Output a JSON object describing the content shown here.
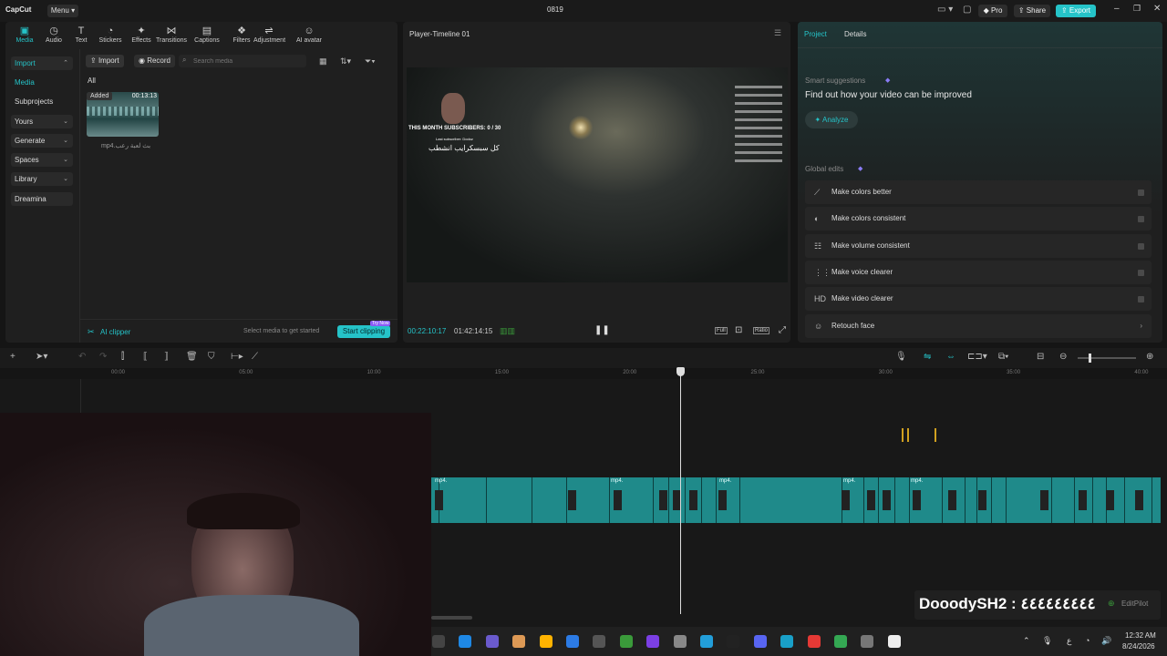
{
  "app": {
    "logo": "CapCut",
    "menu_label": "Menu",
    "title": "0819",
    "pro_label": "Pro",
    "share_label": "Share",
    "export_label": "Export"
  },
  "toolbar": [
    {
      "label": "Media",
      "icon": "media-icon"
    },
    {
      "label": "Audio",
      "icon": "audio-icon"
    },
    {
      "label": "Text",
      "icon": "text-icon"
    },
    {
      "label": "Stickers",
      "icon": "stickers-icon"
    },
    {
      "label": "Effects",
      "icon": "effects-icon"
    },
    {
      "label": "Transitions",
      "icon": "transitions-icon"
    },
    {
      "label": "Captions",
      "icon": "captions-icon"
    },
    {
      "label": "Filters",
      "icon": "filters-icon"
    },
    {
      "label": "Adjustment",
      "icon": "adjustment-icon"
    },
    {
      "label": "AI avatar",
      "icon": "ai-avatar-icon"
    }
  ],
  "sidebar": {
    "items": [
      "Import",
      "Media",
      "Subprojects",
      "Yours",
      "Generate",
      "Spaces",
      "Library",
      "Dreamina"
    ]
  },
  "media": {
    "import_label": "Import",
    "record_label": "Record",
    "search_placeholder": "Search media",
    "filter_all": "All",
    "item_badge": "Added",
    "item_duration": "00:13:13",
    "item_name": "mp4.بث لعبة رعب",
    "ai_clipper": "AI clipper",
    "hint": "Select media to get started",
    "start_clipping": "Start clipping",
    "try_now": "Try Now"
  },
  "player": {
    "title": "Player-Timeline 01",
    "current_time": "00:22:10:17",
    "total_time": "01:42:14:15",
    "overlay_subs": "THIS MONTH SUBSCRIBERS: 0 / 30",
    "overlay_last": "Last subscriber: Dodoz",
    "overlay_arabic": "كل سبسكرايب انشطب",
    "full_label": "Full",
    "ratio_label": "Ratio"
  },
  "right": {
    "tabs": [
      "Project",
      "Details"
    ],
    "smart_title": "Smart suggestions",
    "smart_desc": "Find out how your video can be improved",
    "analyze": "Analyze",
    "global_title": "Global edits",
    "edits": [
      {
        "label": "Make colors better",
        "icon": "wand-icon"
      },
      {
        "label": "Make colors consistent",
        "icon": "palette-icon"
      },
      {
        "label": "Make volume consistent",
        "icon": "sliders-icon"
      },
      {
        "label": "Make voice clearer",
        "icon": "voice-icon"
      },
      {
        "label": "Make video clearer",
        "icon": "hd-icon"
      },
      {
        "label": "Retouch face",
        "icon": "face-icon"
      }
    ]
  },
  "timeline": {
    "ruler": [
      "00:00",
      "05:00",
      "10:00",
      "15:00",
      "20:00",
      "25:00",
      "30:00",
      "35:00",
      "40:00"
    ],
    "clip_label": "mp4."
  },
  "overlay": {
    "chat_text": "DooodySH2 : ٤٤٤٤٤٤٤٤٤",
    "editpilot": "EditPilot"
  },
  "taskbar": {
    "time": "12:32 AM",
    "date": "8/24/2026"
  },
  "colors": {
    "accent": "#25c3c8",
    "clip": "#1f8a8a",
    "panel": "#1f1f1f"
  }
}
